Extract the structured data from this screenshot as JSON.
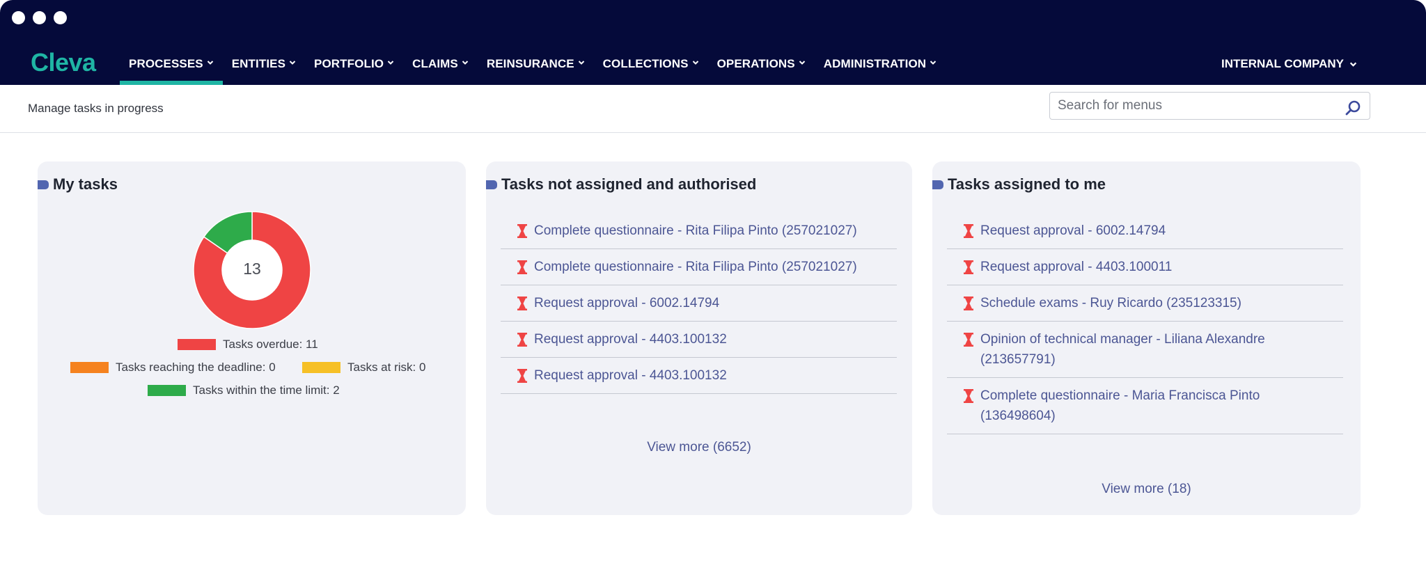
{
  "window": {
    "controls": [
      "dot",
      "dot",
      "dot"
    ]
  },
  "header": {
    "logo": "Cleva",
    "nav": [
      {
        "label": "PROCESSES",
        "active": true
      },
      {
        "label": "ENTITIES"
      },
      {
        "label": "PORTFOLIO"
      },
      {
        "label": "CLAIMS"
      },
      {
        "label": "REINSURANCE"
      },
      {
        "label": "COLLECTIONS"
      },
      {
        "label": "OPERATIONS"
      },
      {
        "label": "ADMINISTRATION"
      }
    ],
    "company": "INTERNAL COMPANY"
  },
  "subheader": {
    "title": "Manage tasks in progress",
    "search": {
      "placeholder": "Search for menus",
      "value": ""
    }
  },
  "colors": {
    "header_bg": "#050a3a",
    "accent": "#1fb5a4",
    "overdue": "#ef4444",
    "reaching_deadline": "#f5821f",
    "at_risk": "#f6c026",
    "within_limit": "#2eab4a",
    "link": "#4c5694"
  },
  "my_tasks": {
    "title": "My tasks",
    "total": "13",
    "chart_data": {
      "type": "pie",
      "categories": [
        "Tasks overdue",
        "Tasks reaching the deadline",
        "Tasks at risk",
        "Tasks within the time limit"
      ],
      "values": [
        11,
        0,
        0,
        2
      ]
    },
    "legend": {
      "overdue": "Tasks overdue: 11",
      "reaching": "Tasks reaching the deadline: 0",
      "at_risk": "Tasks at risk: 0",
      "within": "Tasks within the time limit: 2"
    }
  },
  "not_assigned": {
    "title": "Tasks not assigned and authorised",
    "items": [
      "Complete questionnaire - Rita Filipa Pinto (257021027)",
      "Complete questionnaire - Rita Filipa Pinto (257021027)",
      "Request approval - 6002.14794",
      "Request approval - 4403.100132",
      "Request approval - 4403.100132"
    ],
    "view_more": "View more (6652)"
  },
  "assigned_to_me": {
    "title": "Tasks assigned to me",
    "items": [
      "Request approval - 6002.14794",
      "Request approval - 4403.100011",
      "Schedule exams - Ruy Ricardo (235123315)",
      "Opinion of technical manager - Liliana Alexandre (213657791)",
      "Complete questionnaire - Maria Francisca Pinto (136498604)"
    ],
    "view_more": "View more (18)"
  }
}
